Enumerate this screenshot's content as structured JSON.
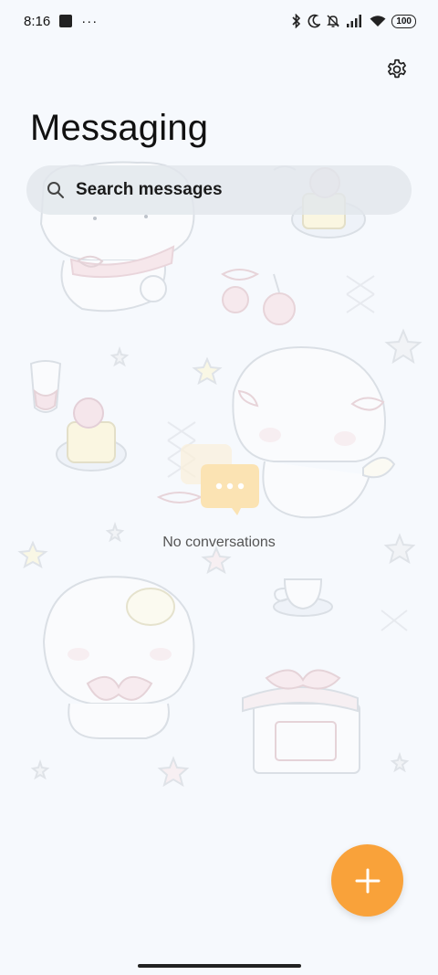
{
  "status_bar": {
    "time": "8:16",
    "more_indicator": "···",
    "battery": "100"
  },
  "header": {
    "title": "Messaging",
    "settings_icon": "gear-icon"
  },
  "search": {
    "placeholder": "Search messages",
    "icon": "search-icon"
  },
  "empty_state": {
    "text": "No conversations",
    "icon": "chat-bubble-icon"
  },
  "fab": {
    "icon": "plus-icon",
    "color": "#f9a23a"
  },
  "theme": {
    "background": "#f6f9fd",
    "accent": "#f9a23a"
  }
}
